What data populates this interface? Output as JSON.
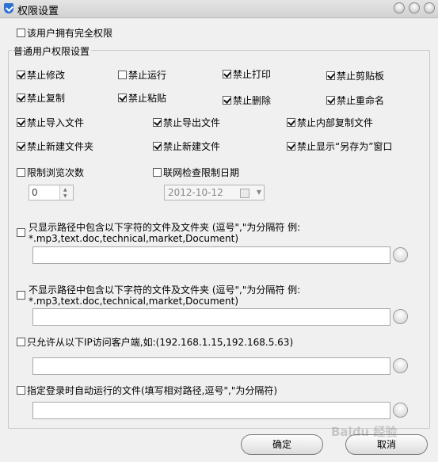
{
  "window": {
    "title": "权限设置"
  },
  "full_permission": {
    "label": "该用户拥有完全权限",
    "checked": false
  },
  "group": {
    "title": "普通用户权限设置",
    "options": [
      {
        "id": "no-modify",
        "label": "禁止修改",
        "checked": true
      },
      {
        "id": "no-run",
        "label": "禁止运行",
        "checked": false
      },
      {
        "id": "no-print",
        "label": "禁止打印",
        "checked": true
      },
      {
        "id": "no-clipboard",
        "label": "禁止剪贴板",
        "checked": true
      },
      {
        "id": "no-copy",
        "label": "禁止复制",
        "checked": true
      },
      {
        "id": "no-paste",
        "label": "禁止粘贴",
        "checked": true
      },
      {
        "id": "no-delete",
        "label": "禁止删除",
        "checked": true
      },
      {
        "id": "no-rename",
        "label": "禁止重命名",
        "checked": true
      },
      {
        "id": "no-import",
        "label": "禁止导入文件",
        "checked": true
      },
      {
        "id": "no-export",
        "label": "禁止导出文件",
        "checked": true
      },
      {
        "id": "no-internal-copy",
        "label": "禁止内部复制文件",
        "checked": true
      },
      {
        "id": "no-new-folder",
        "label": "禁止新建文件夹",
        "checked": true
      },
      {
        "id": "no-new-file",
        "label": "禁止新建文件",
        "checked": true
      },
      {
        "id": "no-save-as",
        "label": "禁止显示“另存为”窗口",
        "checked": true
      }
    ],
    "limit_views": {
      "label": "限制浏览次数",
      "checked": false,
      "value": "0"
    },
    "online_check": {
      "label": "联网检查限制日期",
      "checked": false,
      "date": "2012-10-12"
    },
    "only_show": {
      "label": "只显示路径中包含以下字符的文件及文件夹 (逗号\",\"为分隔符 例:",
      "example": "*.mp3,text.doc,technical,market,Document)",
      "checked": false,
      "value": ""
    },
    "not_show": {
      "label": "不显示路径中包含以下字符的文件及文件夹 (逗号\",\"为分隔符 例:",
      "example": "*.mp3,text.doc,technical,market,Document)",
      "checked": false,
      "value": ""
    },
    "ip_only": {
      "label": "只允许从以下IP访问客户端,如:(192.168.1.15,192.168.5.63)",
      "checked": false,
      "value": ""
    },
    "autorun": {
      "label": "指定登录时自动运行的文件(填写相对路径,逗号\",\"为分隔符)",
      "checked": false,
      "value": ""
    }
  },
  "buttons": {
    "ok": "确定",
    "cancel": "取消"
  },
  "watermark": "Baidu 经验"
}
